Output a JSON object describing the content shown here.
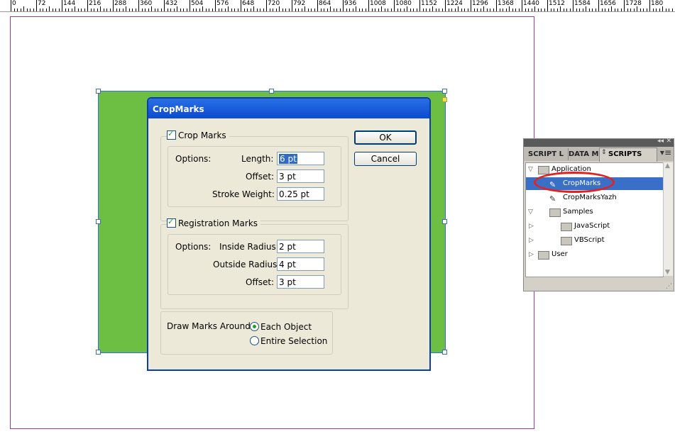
{
  "ruler": {
    "labels": [
      "0",
      "72",
      "144",
      "216",
      "288",
      "360",
      "432",
      "504",
      "576",
      "648",
      "720",
      "792",
      "864",
      "936",
      "1008",
      "1080",
      "1152",
      "1224",
      "1296",
      "1368",
      "1440",
      "1512",
      "1584",
      "1656",
      "1728",
      "180"
    ]
  },
  "dialog": {
    "title": "CropMarks",
    "ok_label": "OK",
    "cancel_label": "Cancel",
    "crop": {
      "legend": "Crop Marks",
      "checked": true,
      "options_label": "Options:",
      "length_label": "Length:",
      "length_value": "6 pt",
      "offset_label": "Offset:",
      "offset_value": "3 pt",
      "stroke_label": "Stroke Weight:",
      "stroke_value": "0.25 pt"
    },
    "reg": {
      "legend": "Registration Marks",
      "checked": true,
      "options_label": "Options:",
      "inside_label": "Inside Radius:",
      "inside_value": "2 pt",
      "outside_label": "Outside Radius:",
      "outside_value": "4 pt",
      "offset_label": "Offset:",
      "offset_value": "3 pt"
    },
    "around": {
      "label": "Draw Marks Around:",
      "options": [
        "Each Object",
        "Entire Selection"
      ],
      "selected": "Each Object"
    }
  },
  "panel": {
    "tabs": [
      "SCRIPT L",
      "DATA ME",
      "SCRIPTS"
    ],
    "active_tab": "SCRIPTS",
    "tree": [
      {
        "label": "Application",
        "type": "folder",
        "expanded": true
      },
      {
        "label": "CropMarks",
        "type": "script",
        "selected": true
      },
      {
        "label": "CropMarksYazh",
        "type": "script"
      },
      {
        "label": "Samples",
        "type": "folder",
        "expanded": true
      },
      {
        "label": "JavaScript",
        "type": "folder",
        "expanded": false
      },
      {
        "label": "VBScript",
        "type": "folder",
        "expanded": false
      },
      {
        "label": "User",
        "type": "folder",
        "expanded": false
      }
    ]
  },
  "colors": {
    "object_fill": "#6cbf42",
    "title_bar": "#0b4bd0",
    "selection": "#3a6fc8",
    "highlight_ellipse": "#e3221e"
  }
}
